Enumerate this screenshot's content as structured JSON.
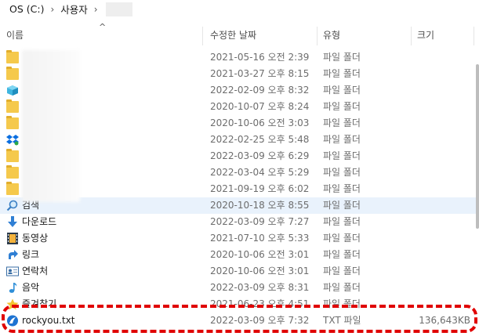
{
  "breadcrumb": {
    "drive": "OS (C:)",
    "folder": "사용자",
    "separator": "›"
  },
  "columns": {
    "name": "이름",
    "date": "수정한 날짜",
    "type": "유형",
    "size": "크기"
  },
  "rows": [
    {
      "name": "",
      "date": "2021-05-16 오전 2:39",
      "type": "파일 폴더",
      "size": "",
      "icon": "folder-icon"
    },
    {
      "name": "",
      "date": "2021-03-27 오후 8:15",
      "type": "파일 폴더",
      "size": "",
      "icon": "folder-icon"
    },
    {
      "name": "",
      "date": "2022-02-09 오후 8:32",
      "type": "파일 폴더",
      "size": "",
      "icon": "cube-3d-icon"
    },
    {
      "name": "",
      "date": "2020-10-07 오후 8:24",
      "type": "파일 폴더",
      "size": "",
      "icon": "folder-icon"
    },
    {
      "name": "",
      "date": "2020-10-06 오전 3:03",
      "type": "파일 폴더",
      "size": "",
      "icon": "folder-icon"
    },
    {
      "name": "",
      "date": "2022-02-25 오후 5:48",
      "type": "파일 폴더",
      "size": "",
      "icon": "dropbox-icon"
    },
    {
      "name": "",
      "date": "2022-03-09 오후 6:29",
      "type": "파일 폴더",
      "size": "",
      "icon": "folder-icon"
    },
    {
      "name": "",
      "date": "2022-03-04 오후 5:29",
      "type": "파일 폴더",
      "size": "",
      "icon": "folder-icon"
    },
    {
      "name": "",
      "date": "2021-09-19 오후 6:02",
      "type": "파일 폴더",
      "size": "",
      "icon": "folder-icon"
    },
    {
      "name": "검색",
      "date": "2020-10-18 오후 8:55",
      "type": "파일 폴더",
      "size": "",
      "icon": "search-icon"
    },
    {
      "name": "다운로드",
      "date": "2022-03-09 오후 7:27",
      "type": "파일 폴더",
      "size": "",
      "icon": "download-arrow-icon"
    },
    {
      "name": "동영상",
      "date": "2021-07-10 오후 5:33",
      "type": "파일 폴더",
      "size": "",
      "icon": "video-film-icon"
    },
    {
      "name": "링크",
      "date": "2020-10-06 오전 3:01",
      "type": "파일 폴더",
      "size": "",
      "icon": "link-arrow-icon"
    },
    {
      "name": "연락처",
      "date": "2020-10-06 오전 3:01",
      "type": "파일 폴더",
      "size": "",
      "icon": "contact-card-icon"
    },
    {
      "name": "음악",
      "date": "2022-03-09 오후 8:31",
      "type": "파일 폴더",
      "size": "",
      "icon": "music-note-icon"
    },
    {
      "name": "즐겨찾기",
      "date": "2021-06-23 오후 4:51",
      "type": "파일 폴더",
      "size": "",
      "icon": "star-icon"
    },
    {
      "name": "rockyou.txt",
      "date": "2022-03-09 오후 7:32",
      "type": "TXT 파일",
      "size": "136,643KB",
      "icon": "txt-file-icon"
    }
  ],
  "hover_row_index": 9,
  "highlighted_row_index": 16,
  "colors": {
    "highlight": "#e00000",
    "hover": "#e9f2fc",
    "folder": "#f5c94c"
  }
}
